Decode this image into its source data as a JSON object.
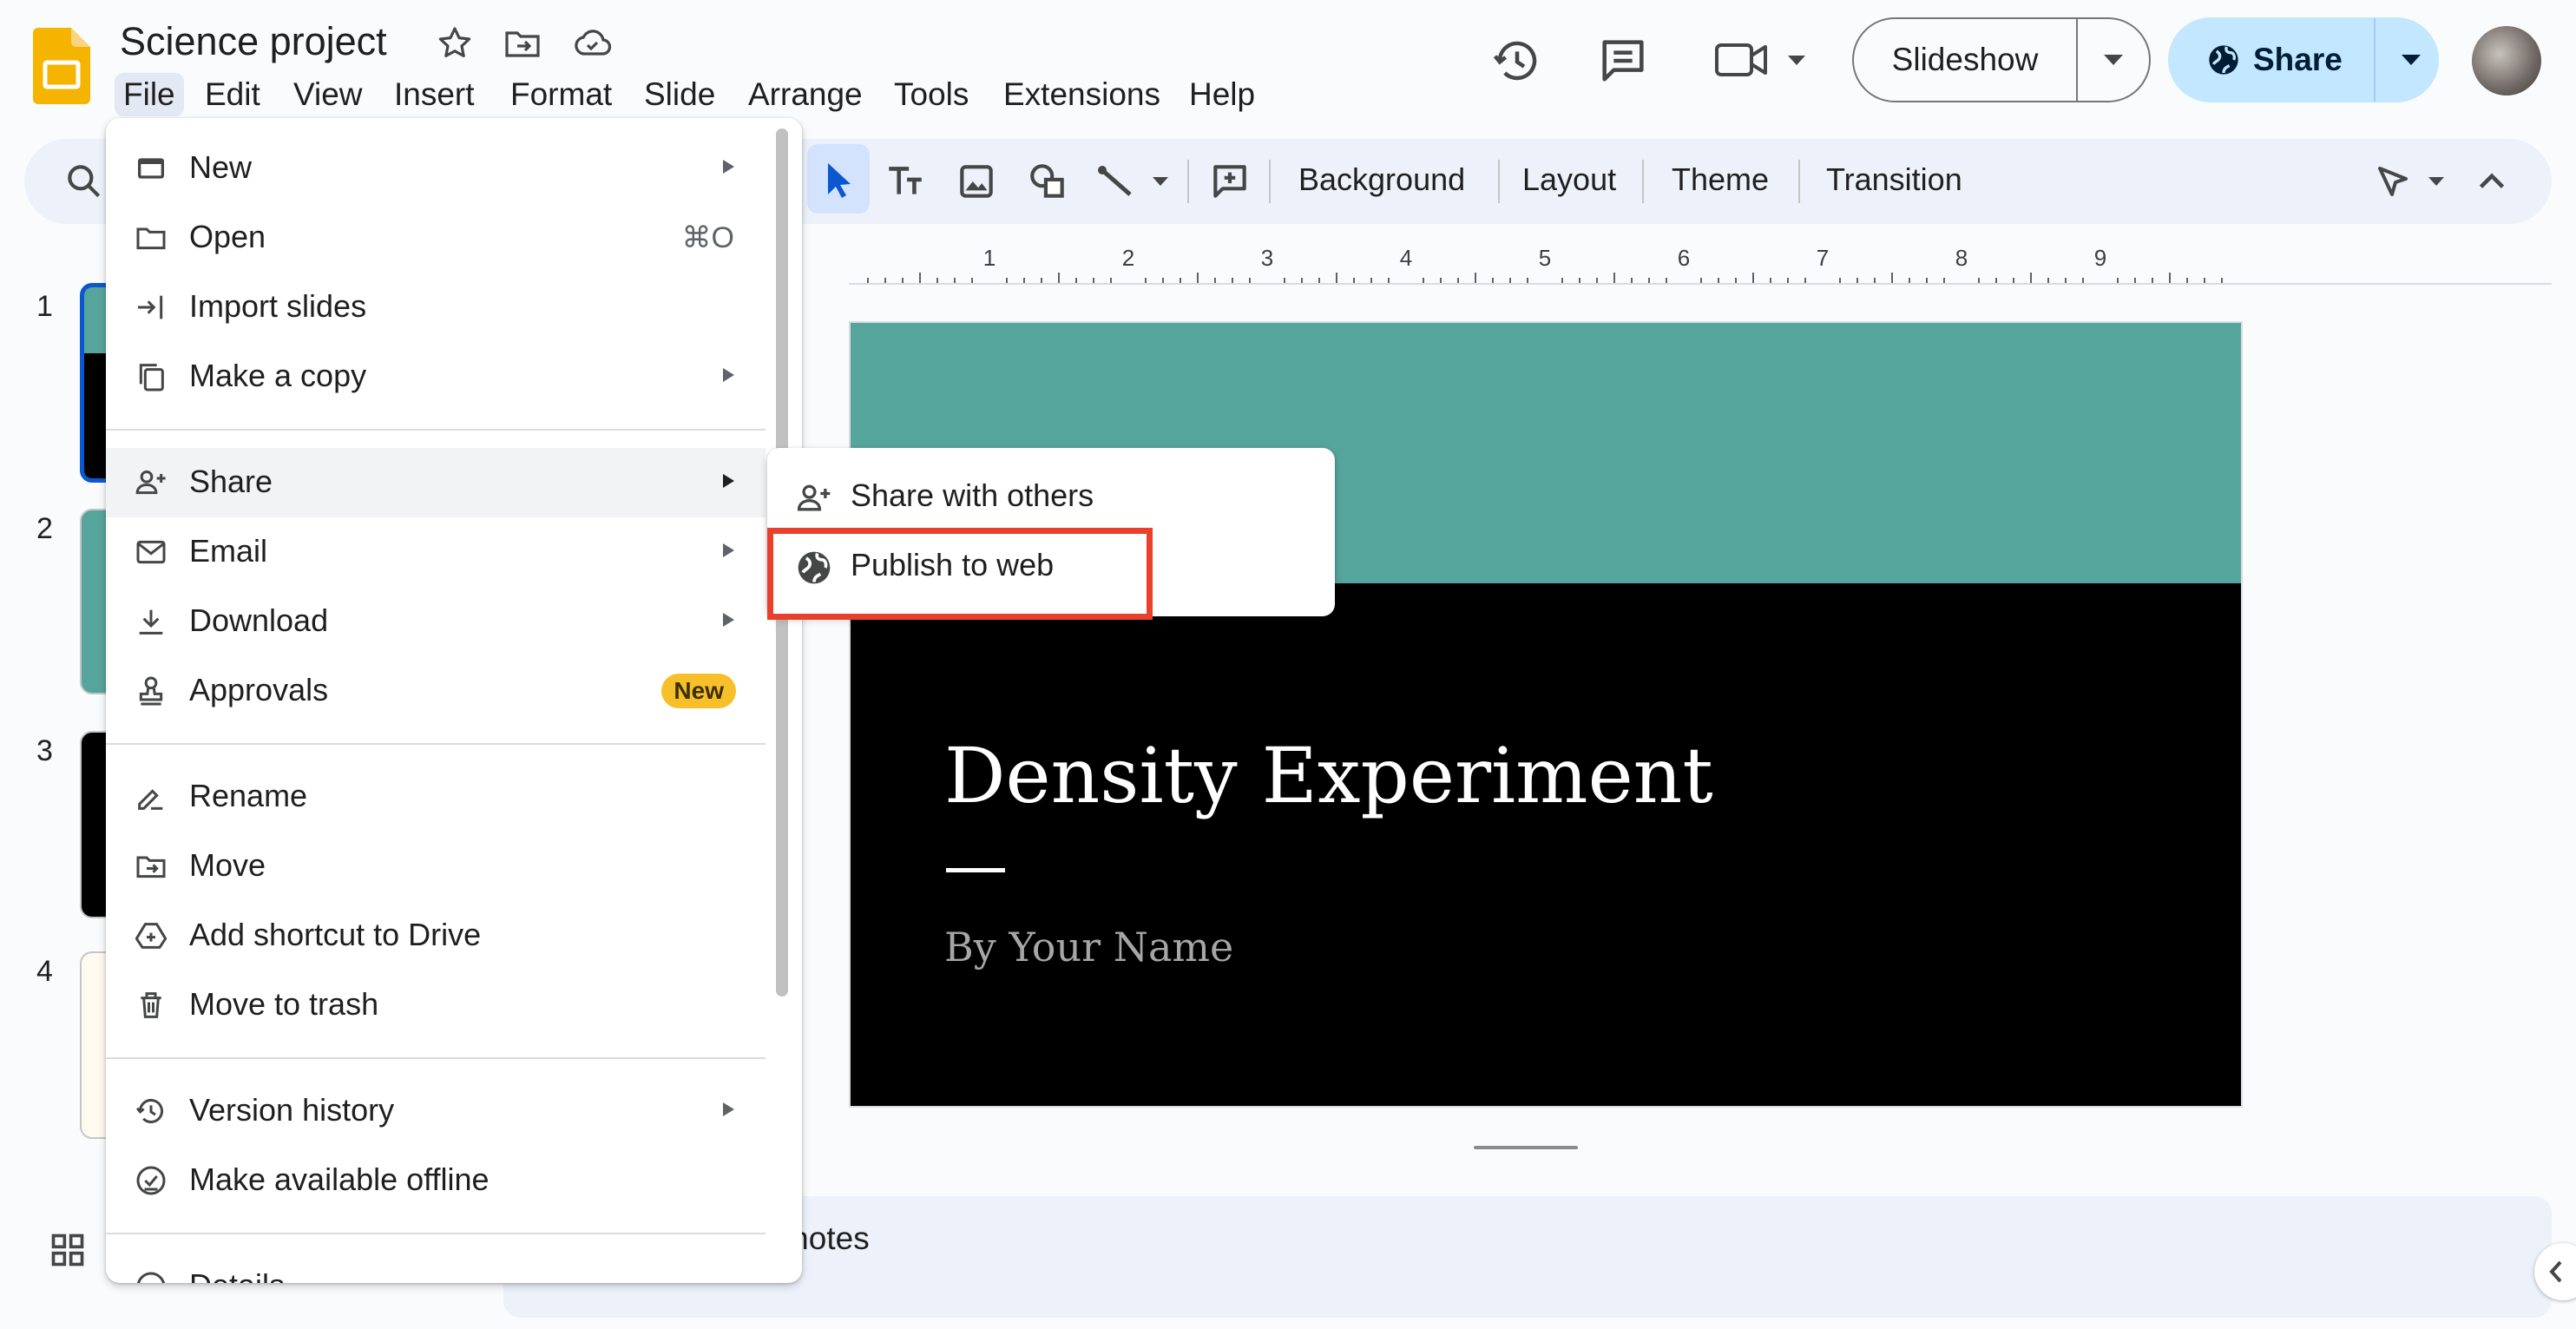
{
  "header": {
    "title": "Science project",
    "menu": [
      "File",
      "Edit",
      "View",
      "Insert",
      "Format",
      "Slide",
      "Arrange",
      "Tools",
      "Extensions",
      "Help"
    ],
    "active_menu": "File",
    "slideshow_label": "Slideshow",
    "share_label": "Share",
    "accent_color": "#c2e7ff"
  },
  "toolbar": {
    "background_label": "Background",
    "layout_label": "Layout",
    "theme_label": "Theme",
    "transition_label": "Transition"
  },
  "ruler": {
    "ticks": [
      "1",
      "2",
      "3",
      "4",
      "5",
      "6",
      "7",
      "8",
      "9"
    ]
  },
  "slide_rail": {
    "numbers": [
      "1",
      "2",
      "3",
      "4"
    ]
  },
  "slide": {
    "title": "Density Experiment",
    "subtitle": "By Your Name",
    "band_color": "#56a59c"
  },
  "notes": {
    "text": "er notes"
  },
  "file_menu": {
    "items": [
      {
        "label": "New",
        "icon": "slides-icon",
        "arrow": true
      },
      {
        "label": "Open",
        "icon": "folder-icon",
        "shortcut": "⌘O"
      },
      {
        "label": "Import slides",
        "icon": "import-icon"
      },
      {
        "label": "Make a copy",
        "icon": "copy-icon",
        "arrow": true
      },
      {
        "label": "Share",
        "icon": "person-add-icon",
        "arrow": true
      },
      {
        "label": "Email",
        "icon": "mail-icon",
        "arrow": true
      },
      {
        "label": "Download",
        "icon": "download-icon",
        "arrow": true
      },
      {
        "label": "Approvals",
        "icon": "approvals-icon",
        "badge": "New"
      },
      {
        "label": "Rename",
        "icon": "rename-icon"
      },
      {
        "label": "Move",
        "icon": "move-folder-icon"
      },
      {
        "label": "Add shortcut to Drive",
        "icon": "drive-shortcut-icon"
      },
      {
        "label": "Move to trash",
        "icon": "trash-icon"
      },
      {
        "label": "Version history",
        "icon": "history-icon",
        "arrow": true
      },
      {
        "label": "Make available offline",
        "icon": "offline-icon"
      },
      {
        "label": "Details",
        "icon": "info-icon"
      }
    ]
  },
  "share_submenu": {
    "items": [
      {
        "label": "Share with others",
        "icon": "person-add-icon"
      },
      {
        "label": "Publish to web",
        "icon": "globe-icon"
      }
    ],
    "highlight_color": "#e8402a"
  }
}
